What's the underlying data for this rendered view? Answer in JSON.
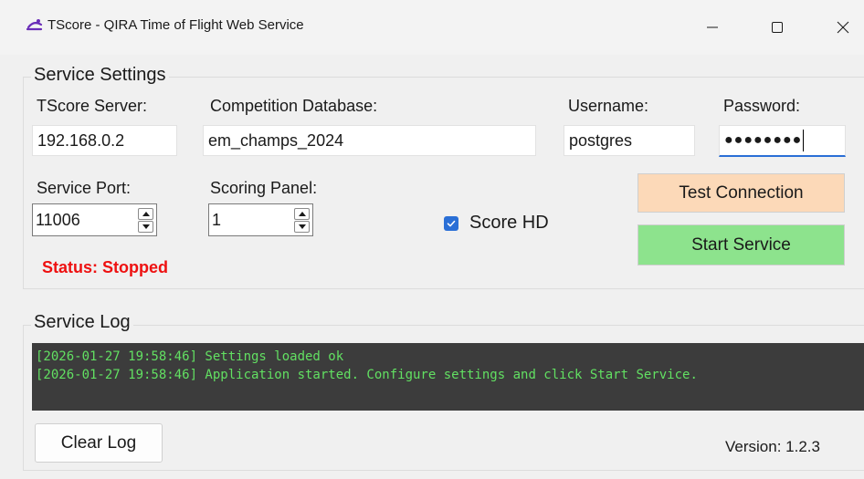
{
  "window": {
    "title": "TScore - QIRA Time of Flight Web Service",
    "icon": "tscore-logo-icon",
    "controls": [
      "minimize-icon",
      "maximize-icon",
      "close-icon"
    ]
  },
  "settings": {
    "group_title": "Service Settings",
    "server_label": "TScore Server:",
    "server_value": "192.168.0.2",
    "database_label": "Competition Database:",
    "database_value": "em_champs_2024",
    "username_label": "Username:",
    "username_value": "postgres",
    "password_label": "Password:",
    "password_dots": "●●●●●●●●",
    "port_label": "Service Port:",
    "port_value": "11006",
    "panel_label": "Scoring Panel:",
    "panel_value": "1",
    "score_hd_label": "Score HD",
    "score_hd_checked": true,
    "status_text": "Status: Stopped",
    "test_button_label": "Test Connection",
    "start_button_label": "Start Service"
  },
  "log": {
    "group_title": "Service Log",
    "lines": [
      "[2026-01-27 19:58:46] Settings loaded ok",
      "[2026-01-27 19:58:46] Application started. Configure settings and click Start Service."
    ],
    "clear_button_label": "Clear Log"
  },
  "version_text": "Version: 1.2.3",
  "colors": {
    "status": "#ee1111",
    "test_button_bg": "#fcd9b8",
    "start_button_bg": "#8de38d",
    "log_text": "#62e062",
    "log_bg": "#3c3c3c",
    "accent": "#2a6fd6",
    "logo": "#6a2db8"
  }
}
